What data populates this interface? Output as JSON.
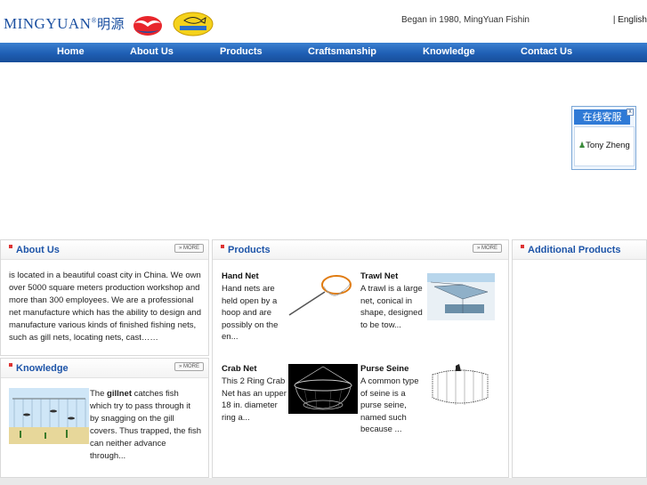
{
  "header": {
    "logo_text": "MINGYUAN",
    "logo_reg": "®",
    "logo_cn": "明源",
    "logo_icons": [
      "bird-logo-icon",
      "bigfish-logo-icon"
    ],
    "tagline": "Began in 1980, MingYuan Fishin",
    "language": "| English"
  },
  "nav": {
    "items": [
      {
        "label": "Home"
      },
      {
        "label": "About Us"
      },
      {
        "label": "Products"
      },
      {
        "label": "Craftsmanship"
      },
      {
        "label": "Knowledge"
      },
      {
        "label": "Contact Us"
      }
    ],
    "colors": {
      "bar": "#1f5fb4",
      "text": "#ffffff"
    }
  },
  "chat": {
    "title": "在线客服",
    "close": "x",
    "agent": "Tony Zheng",
    "agent_icon": "user-group-icon"
  },
  "about": {
    "title": "About Us",
    "more": "» MORE",
    "text": "is located in a beautiful coast city in China. We own over 5000 square meters production workshop and more than 300 employees. We are a professional net manufacture which has the ability to design and manufacture various kinds of finished fishing nets, such as gill nets, locating nets, cast……"
  },
  "knowledge": {
    "title": "Knowledge",
    "more": "» MORE",
    "text_pre": "The ",
    "text_bold": "gillnet",
    "text_post": " catches fish which try to pass through it by snagging on the gill covers. Thus trapped, the fish can neither advance through..."
  },
  "products": {
    "title": "Products",
    "more": "» MORE",
    "items": [
      {
        "name": "Hand Net",
        "desc": "Hand nets are held open by a hoop and are possibly on the en..."
      },
      {
        "name": "Trawl Net",
        "desc": "A trawl is a large net, conical in shape, designed to be tow..."
      },
      {
        "name": "Crab Net",
        "desc": "This 2 Ring Crab Net has an upper 18 in. diameter ring a..."
      },
      {
        "name": "Purse Seine",
        "desc": "A common type of seine is a purse seine, named such because ..."
      }
    ]
  },
  "additional": {
    "title": "Additional Products"
  },
  "colors": {
    "accent": "#1d54a8",
    "flag": "#dd3333"
  }
}
